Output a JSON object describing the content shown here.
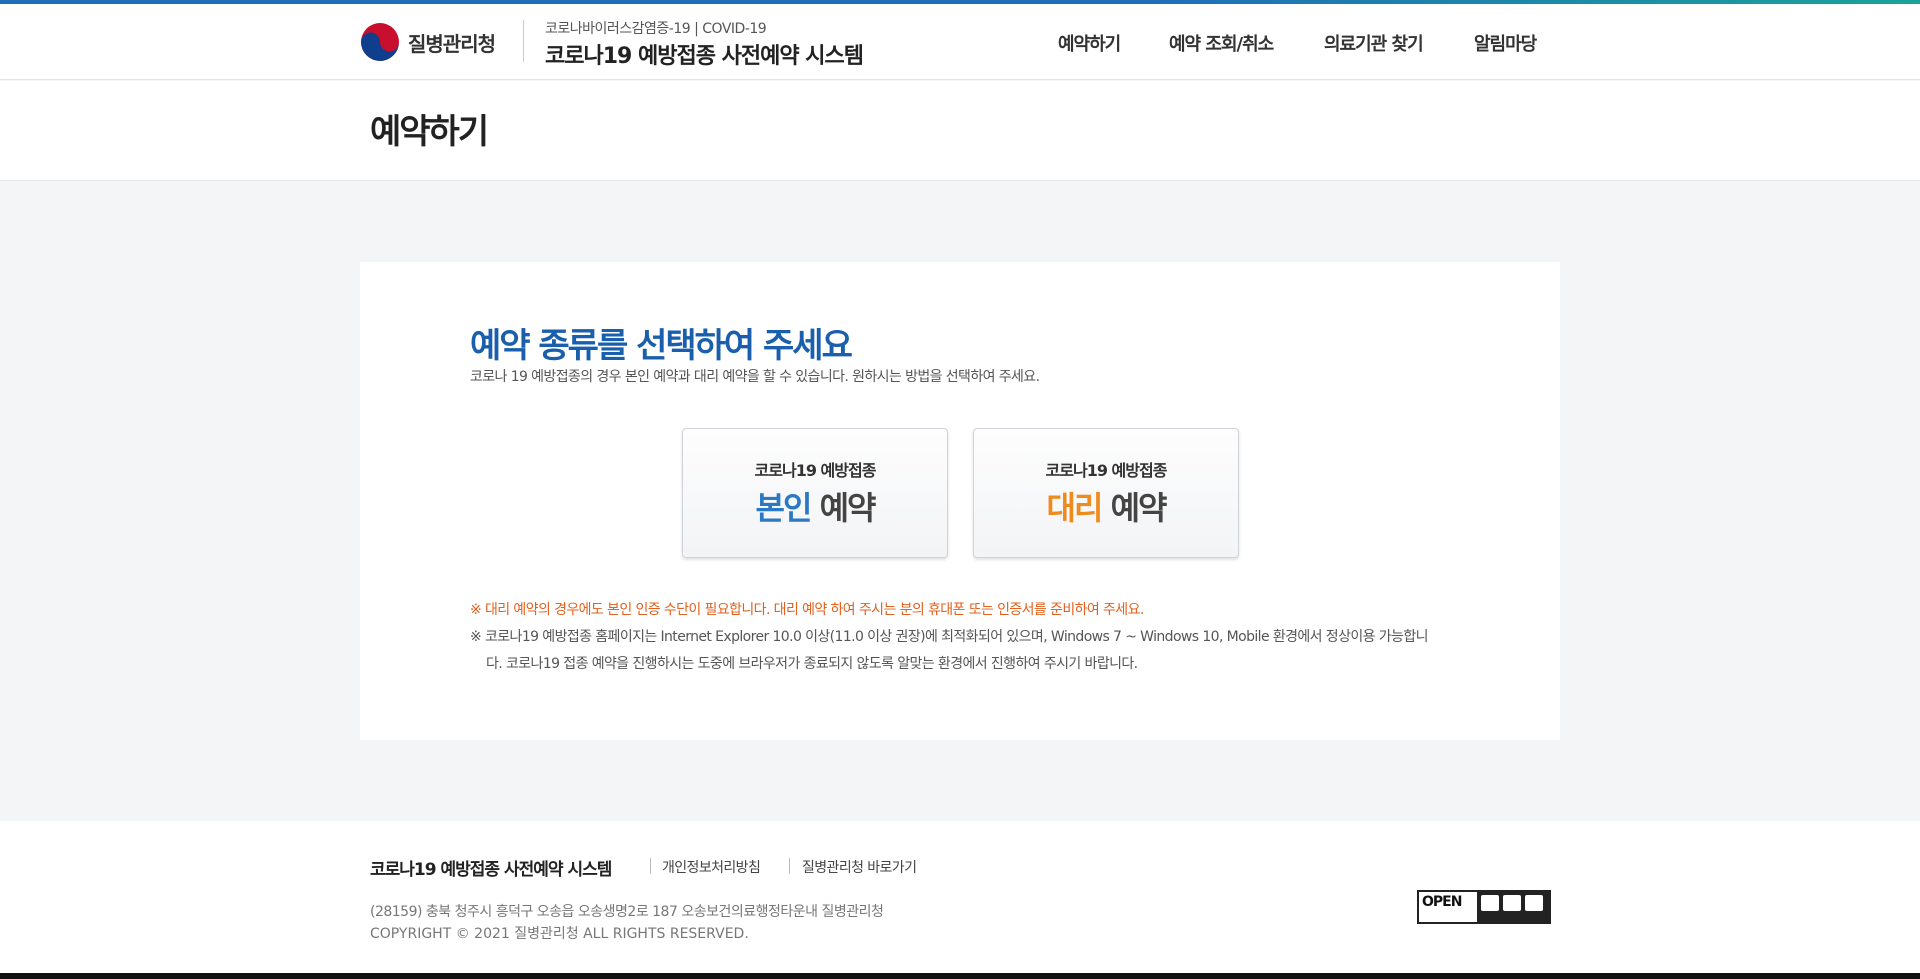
{
  "header": {
    "logo_text": "질병관리청",
    "system_subtitle": "코로나바이러스감염증-19 | COVID-19",
    "system_title": "코로나19 예방접종 사전예약 시스템"
  },
  "nav": [
    {
      "label": "예약하기"
    },
    {
      "label": "예약 조회/취소"
    },
    {
      "label": "의료기관 찾기"
    },
    {
      "label": "알림마당"
    }
  ],
  "page": {
    "title": "예약하기"
  },
  "panel": {
    "title": "예약 종류를 선택하여 주세요",
    "description": "코로나 19 예방접종의 경우 본인 예약과 대리 예약을 할 수 있습니다. 원하시는 방법을 선택하여 주세요.",
    "choices": [
      {
        "subtitle": "코로나19 예방접종",
        "highlight": "본인",
        "label": "예약",
        "highlight_color": "#2b78c5"
      },
      {
        "subtitle": "코로나19 예방접종",
        "highlight": "대리",
        "label": "예약",
        "highlight_color": "#ef8a1c"
      }
    ],
    "notice_warning": "※ 대리 예약의 경우에도 본인 인증 수단이 필요합니다. 대리 예약 하여 주시는 분의 휴대폰 또는 인증서를 준비하여 주세요.",
    "notice_browser_line1": "※ 코로나19 예방접종 홈페이지는 Internet Explorer 10.0 이상(11.0 이상 권장)에 최적화되어 있으며, Windows 7 ~ Windows 10, Mobile 환경에서 정상이용 가능합니",
    "notice_browser_line2": "다. 코로나19 접종 예약을 진행하시는 도중에 브라우저가 종료되지 않도록 알맞는 환경에서 진행하여 주시기 바랍니다."
  },
  "footer": {
    "title": "코로나19 예방접종 사전예약 시스템",
    "links": [
      {
        "label": "개인정보처리방침"
      },
      {
        "label": "질병관리청 바로가기"
      }
    ],
    "address": "(28159) 충북 청주시 흥덕구 오송읍 오송생명2로 187 오송보건의료행정타운내 질병관리청",
    "copyright": "COPYRIGHT © 2021 질병관리청 ALL RIGHTS RESERVED.",
    "kogl_label": "OPEN"
  },
  "colors": {
    "accent_blue": "#1a5fad",
    "accent_orange": "#ef8a1c",
    "warning_text": "#e2611e"
  }
}
